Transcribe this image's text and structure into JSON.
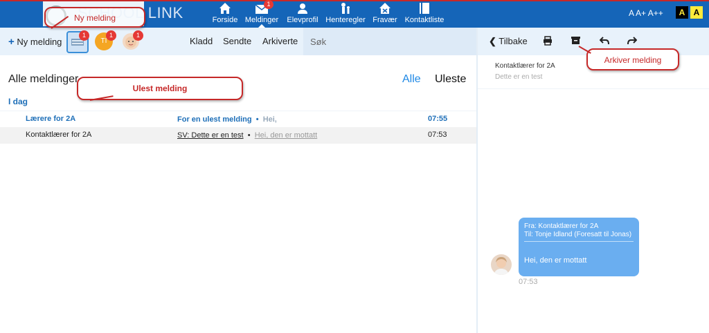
{
  "header": {
    "logo_text": "SCHOOL LINK",
    "nav": [
      {
        "label": "Forside",
        "icon": "home-icon"
      },
      {
        "label": "Meldinger",
        "icon": "envelope-icon",
        "badge": "1"
      },
      {
        "label": "Elevprofil",
        "icon": "person-icon"
      },
      {
        "label": "Henteregler",
        "icon": "pickup-icon"
      },
      {
        "label": "Fravær",
        "icon": "house-x-icon"
      },
      {
        "label": "Kontaktliste",
        "icon": "book-icon"
      }
    ],
    "font_sizes": "A A+ A++",
    "contrast_dark": "A",
    "contrast_light": "A"
  },
  "toolbar": {
    "new_message": "Ny melding",
    "filters": [
      {
        "icon": "inbox-icon",
        "badge": "1"
      },
      {
        "icon": "avatar-ti-icon",
        "initials": "TI",
        "badge": "1"
      },
      {
        "icon": "avatar-child-icon",
        "badge": "1"
      }
    ],
    "tabs": [
      "Kladd",
      "Sendte",
      "Arkiverte"
    ],
    "search_placeholder": "Søk"
  },
  "reader_toolbar": {
    "back_label": "Tilbake",
    "actions": [
      "print-icon",
      "archive-icon",
      "reply-icon",
      "forward-icon"
    ]
  },
  "list": {
    "title": "Alle meldinger",
    "filter_all": "Alle",
    "filter_unread": "Uleste",
    "section": "I dag",
    "rows": [
      {
        "from": "Lærere for 2A",
        "subject": "For en ulest melding",
        "sep": "•",
        "preview": "Hei,",
        "time": "07:55",
        "unread": true
      },
      {
        "from": "Kontaktlærer for 2A",
        "subject": "SV: Dette er en test",
        "sep": "•",
        "preview": "Hei, den er mottatt",
        "time": "07:53",
        "unread": false
      }
    ]
  },
  "thread": {
    "from": "Kontaktlærer for 2A",
    "preview": "Dette er en test",
    "bubble": {
      "from": "Fra: Kontaktlærer for 2A",
      "to": "Til: Tonje Idland (Foresatt til Jonas)",
      "message": "Hei, den er mottatt",
      "time": "07:53"
    }
  },
  "annotations": {
    "new_message": "Ny melding",
    "unread": "Ulest melding",
    "archive": "Arkiver melding"
  },
  "colors": {
    "primary": "#1565b8",
    "accent": "#1e88e5",
    "badge": "#e53935",
    "callout": "#c62828",
    "bubble": "#6aaef0"
  }
}
